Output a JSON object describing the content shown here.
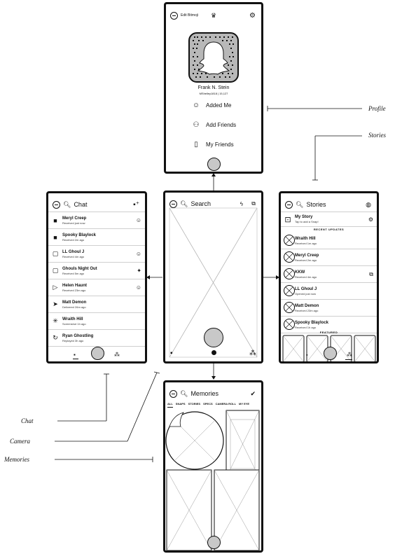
{
  "profile": {
    "edit_bitmoji": "Edit Bitmoji",
    "name": "Frank N. Stein",
    "username": "MShelley1818 | 15,127",
    "items": [
      {
        "label": "Added Me",
        "icon": "smiley-icon"
      },
      {
        "label": "Add Friends",
        "icon": "add-friend-icon"
      },
      {
        "label": "My Friends",
        "icon": "book-icon"
      }
    ]
  },
  "chat": {
    "title": "Chat",
    "rows": [
      {
        "name": "Meryl Creep",
        "status": "Received just now",
        "icon": "■",
        "right": "☺"
      },
      {
        "name": "Spooky Blaylock",
        "status": "Received 2m ago",
        "icon": "■",
        "right": ""
      },
      {
        "name": "LL Ghoul J",
        "status": "Received 4m ago",
        "icon": "▢",
        "right": "☺"
      },
      {
        "name": "Ghouls Night Out",
        "status": "Received 5m ago",
        "icon": "▢",
        "right": "✦"
      },
      {
        "name": "Helen Haunt",
        "status": "Received 23m ago",
        "icon": "▷",
        "right": "☺"
      },
      {
        "name": "Matt Demon",
        "status": "Delivered 26m ago",
        "icon": "➤",
        "right": ""
      },
      {
        "name": "Wraith Hill",
        "status": "Screenshot 1h ago",
        "icon": "✳",
        "right": ""
      },
      {
        "name": "Ryan Ghostling",
        "status": "Replayed 3h ago",
        "icon": "↻",
        "right": ""
      }
    ]
  },
  "camera": {
    "title": "Search"
  },
  "stories": {
    "title": "Stories",
    "my_story": "My Story",
    "my_story_sub": "Tap to add a Snap!",
    "recent_updates": "RECENT UPDATES",
    "featured": "FEATURED",
    "rows": [
      {
        "name": "Wraith Hill",
        "status": "Received 1m ago",
        "right": ""
      },
      {
        "name": "Meryl Creep",
        "status": "Received 2m ago",
        "right": ""
      },
      {
        "name": "KKW",
        "status": "Received 4m ago",
        "right": "⧉"
      },
      {
        "name": "LL Ghoul J",
        "status": "Opened just now",
        "right": ""
      },
      {
        "name": "Matt Demon",
        "status": "Received 23m ago",
        "right": ""
      },
      {
        "name": "Spooky Blaylock",
        "status": "Received 1h ago",
        "right": ""
      }
    ]
  },
  "memories": {
    "title": "Memories",
    "tabs": [
      "ALL",
      "SNAPS",
      "STORIES",
      "SPECS",
      "CAMERA ROLL",
      "MY EYE"
    ]
  },
  "annotations": {
    "profile": "Profile",
    "stories": "Stories",
    "chat": "Chat",
    "camera": "Camera",
    "memories": "Memories"
  }
}
